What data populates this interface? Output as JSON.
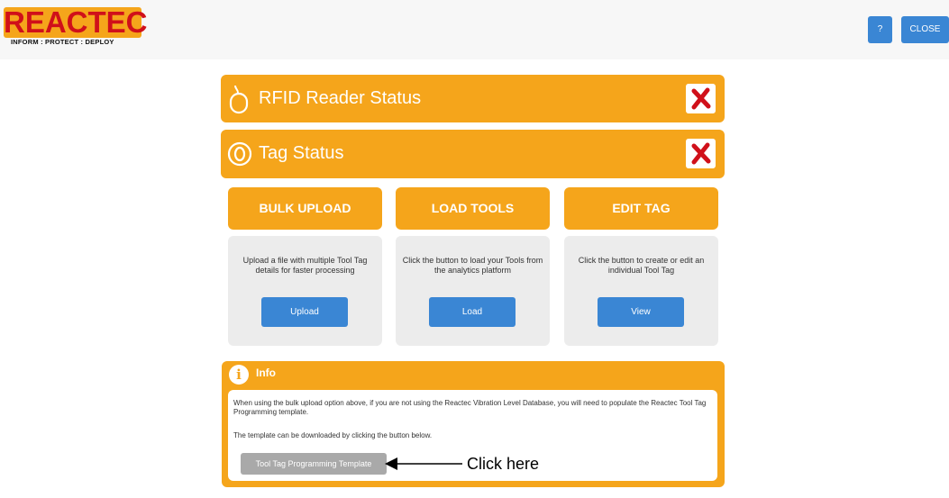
{
  "header": {
    "logo_text": "REACTEC",
    "logo_tagline": "INFORM : PROTECT : DEPLOY",
    "help_label": "?",
    "close_label": "CLOSE"
  },
  "status": {
    "rfid_label": "RFID Reader Status",
    "tag_label": "Tag Status",
    "rfid_state_icon": "red-x-icon",
    "tag_state_icon": "red-x-icon"
  },
  "columns": [
    {
      "title": "BULK UPLOAD",
      "description": "Upload a file with multiple Tool Tag details for faster processing",
      "button": "Upload"
    },
    {
      "title": "LOAD TOOLS",
      "description": "Click the button to load your Tools from the analytics platform",
      "button": "Load"
    },
    {
      "title": "EDIT TAG",
      "description": "Click the button to create or edit an individual Tool Tag",
      "button": "View"
    }
  ],
  "info": {
    "title": "Info",
    "text1": "When using the bulk upload option above, if you are not using the Reactec Vibration Level Database, you will need to populate the Reactec Tool Tag Programming template.",
    "text2": "The template can be downloaded by clicking the button below.",
    "template_button": "Tool Tag Programming Template"
  },
  "annotation": {
    "click_here": "Click here"
  },
  "colors": {
    "accent_orange": "#f5a51b",
    "button_blue": "#3a86d4",
    "logo_red": "#d0101a",
    "panel_grey": "#ececec",
    "template_grey": "#a9a9a9"
  }
}
